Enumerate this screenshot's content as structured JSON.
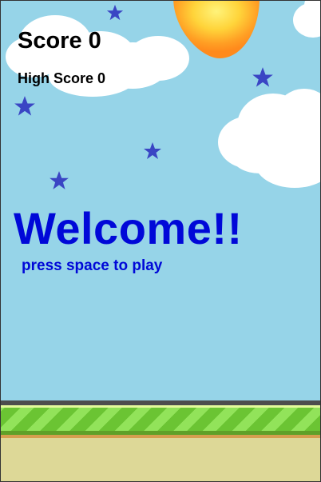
{
  "hud": {
    "score_label": "Score 0",
    "high_score_label": "High Score 0"
  },
  "title": {
    "welcome": "Welcome!!",
    "prompt": "press space to play"
  },
  "colors": {
    "sky": "#96d4e8",
    "title_text": "#0008d8",
    "star": "#3a45c4",
    "grass_light": "#92e35a",
    "grass_dark": "#6bc433",
    "dirt": "#ddd897"
  },
  "icons": [
    "star-icon",
    "sun-icon",
    "cloud"
  ]
}
